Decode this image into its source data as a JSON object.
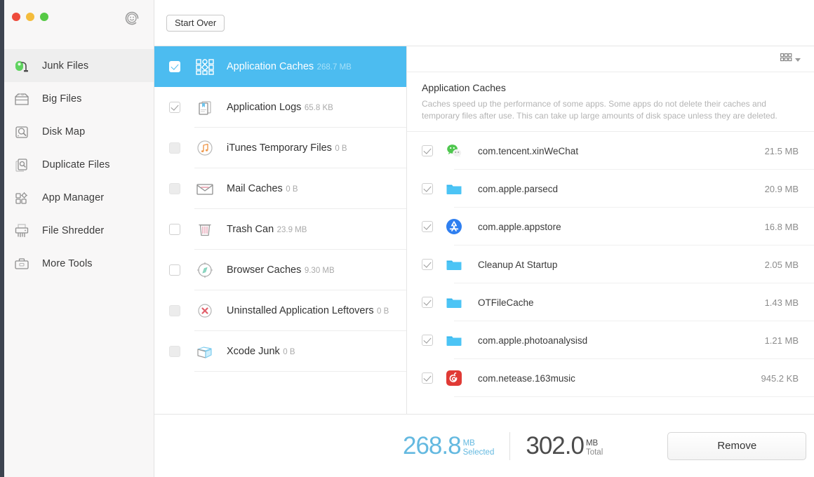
{
  "window": {
    "traffic_lights": [
      "close",
      "minimize",
      "maximize"
    ],
    "support_icon": "smiley-support-icon"
  },
  "sidebar": {
    "items": [
      {
        "label": "Junk Files",
        "icon": "vacuum-icon",
        "active": true
      },
      {
        "label": "Big Files",
        "icon": "box-icon",
        "active": false
      },
      {
        "label": "Disk Map",
        "icon": "disk-magnifier-icon",
        "active": false
      },
      {
        "label": "Duplicate Files",
        "icon": "documents-search-icon",
        "active": false
      },
      {
        "label": "App Manager",
        "icon": "apps-gear-icon",
        "active": false
      },
      {
        "label": "File Shredder",
        "icon": "shredder-icon",
        "active": false
      },
      {
        "label": "More Tools",
        "icon": "toolbox-icon",
        "active": false
      }
    ]
  },
  "toolbar": {
    "start_over_label": "Start Over"
  },
  "categories": [
    {
      "name": "Application Caches",
      "size": "268.7 MB",
      "icon": "grid-squares-icon",
      "checked": true,
      "disabled": false,
      "selected": true
    },
    {
      "name": "Application Logs",
      "size": "65.8 KB",
      "icon": "logs-icon",
      "checked": true,
      "disabled": false,
      "selected": false
    },
    {
      "name": "iTunes Temporary Files",
      "size": "0 B",
      "icon": "music-note-icon",
      "checked": false,
      "disabled": true,
      "selected": false
    },
    {
      "name": "Mail Caches",
      "size": "0 B",
      "icon": "envelope-icon",
      "checked": false,
      "disabled": true,
      "selected": false
    },
    {
      "name": "Trash Can",
      "size": "23.9 MB",
      "icon": "trash-icon",
      "checked": false,
      "disabled": false,
      "selected": false
    },
    {
      "name": "Browser Caches",
      "size": "9.30 MB",
      "icon": "compass-icon",
      "checked": false,
      "disabled": false,
      "selected": false
    },
    {
      "name": "Uninstalled Application Leftovers",
      "size": "0 B",
      "icon": "circle-x-icon",
      "checked": false,
      "disabled": true,
      "selected": false
    },
    {
      "name": "Xcode Junk",
      "size": "0 B",
      "icon": "xcode-icon",
      "checked": false,
      "disabled": true,
      "selected": false
    }
  ],
  "detail": {
    "view_mode_icon": "grid-view-icon",
    "title": "Application Caches",
    "description": "Caches speed up the performance of some apps. Some apps do not delete their caches and temporary files after use. This can take up large amounts of disk space unless they are deleted.",
    "files": [
      {
        "name": "com.tencent.xinWeChat",
        "size": "21.5 MB",
        "icon": "wechat-icon",
        "checked": true
      },
      {
        "name": "com.apple.parsecd",
        "size": "20.9 MB",
        "icon": "folder-icon",
        "checked": true
      },
      {
        "name": "com.apple.appstore",
        "size": "16.8 MB",
        "icon": "app-store-icon",
        "checked": true
      },
      {
        "name": "Cleanup At Startup",
        "size": "2.05 MB",
        "icon": "folder-icon",
        "checked": true
      },
      {
        "name": "OTFileCache",
        "size": "1.43 MB",
        "icon": "folder-icon",
        "checked": true
      },
      {
        "name": "com.apple.photoanalysisd",
        "size": "1.21 MB",
        "icon": "folder-icon",
        "checked": true
      },
      {
        "name": "com.netease.163music",
        "size": "945.2 KB",
        "icon": "netease-music-icon",
        "checked": true
      }
    ]
  },
  "footer": {
    "selected_value": "268.8",
    "selected_unit": "MB",
    "selected_label": "Selected",
    "total_value": "302.0",
    "total_unit": "MB",
    "total_label": "Total",
    "remove_label": "Remove"
  },
  "colors": {
    "accent_blue": "#4cbcf0",
    "selected_text_blue": "#64b9e0",
    "sidebar_bg": "#f8f7f7"
  }
}
